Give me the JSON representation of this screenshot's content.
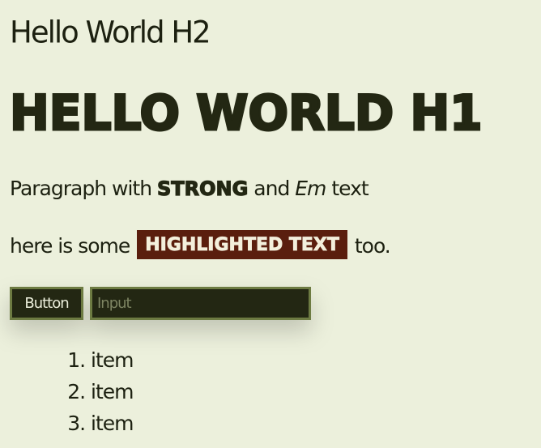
{
  "heading2": "Hello World H2",
  "heading1": "Hello World H1",
  "paragraph1": {
    "before": "Paragraph with ",
    "strong": "Strong",
    "middle": " and ",
    "em": "Em",
    "after": " text"
  },
  "paragraph2": {
    "before": "here is some ",
    "mark": "Highlighted Text",
    "after": " too."
  },
  "controls": {
    "button_label": "Button",
    "input_value": "",
    "input_placeholder": "Input"
  },
  "list": {
    "items": [
      "item",
      "item",
      "item"
    ]
  },
  "colors": {
    "background": "#ecf0dc",
    "text": "#1c2010",
    "control_bg": "#232713",
    "control_border": "#6d7b42",
    "mark_bg": "#5a1e0e"
  }
}
